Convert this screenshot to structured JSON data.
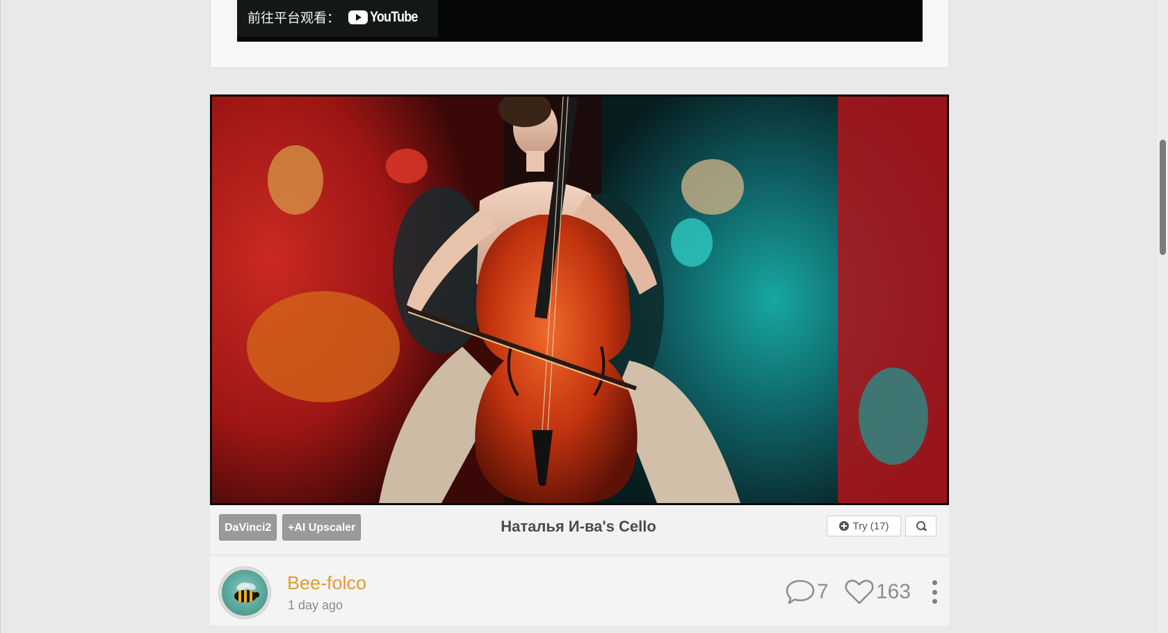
{
  "embed": {
    "watch_on_label": "前往平台观看：",
    "platform": "YouTube"
  },
  "post": {
    "artwork_alt": "Woman playing a cello, expressive abstract painting",
    "tags": [
      "DaVinci2",
      "+AI Upscaler"
    ],
    "title": "Наталья И-ва's Cello",
    "try_label": "Try (17)",
    "author": {
      "name": "Bee-folco",
      "time": "1 day ago"
    },
    "comments_count": "7",
    "likes_count": "163"
  },
  "colors": {
    "accent_author": "#e39a33",
    "tag_bg": "#9a9a9a",
    "page_bg": "#e9e9e9"
  },
  "icons": {
    "try": "plus-circle-icon",
    "search": "search-icon",
    "comments": "speech-bubble-icon",
    "likes": "heart-icon",
    "more": "vertical-ellipsis-icon",
    "youtube": "youtube-play-icon"
  }
}
